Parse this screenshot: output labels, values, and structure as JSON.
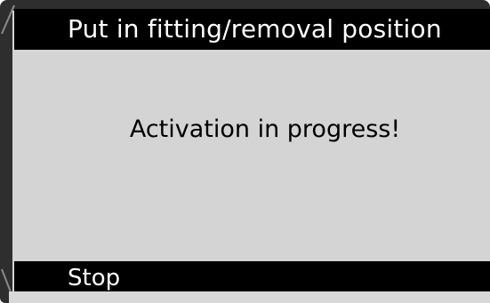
{
  "screen": {
    "title": "Put in fitting/removal position",
    "message": "Activation in progress!"
  },
  "softkeys": {
    "stop_label": "Stop"
  },
  "colors": {
    "frame": "#2e2e2e",
    "screen_background": "#d4d4d4",
    "bar_background": "#000000",
    "bar_text": "#ffffff",
    "body_text": "#000000"
  }
}
